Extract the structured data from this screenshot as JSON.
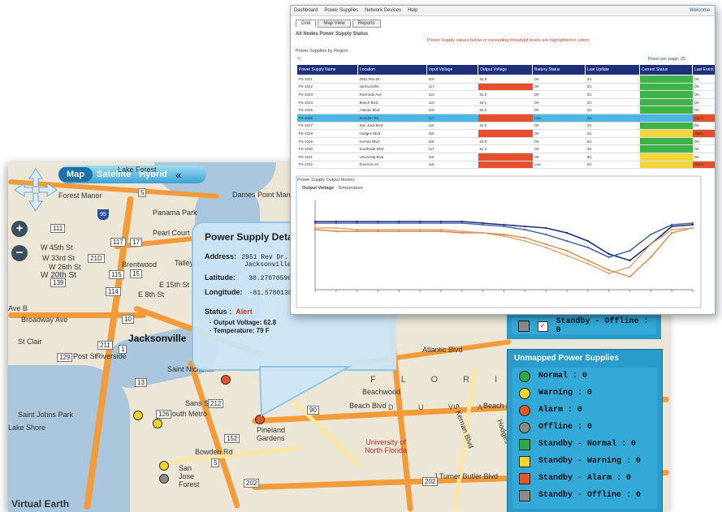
{
  "map": {
    "types": [
      "Map",
      "Satellite",
      "Hybrid"
    ],
    "collapse": "«",
    "labels": {
      "jacksonville": "Jacksonville",
      "lake_forest": "Lake Forest",
      "forest_manor": "Forest Manor",
      "dames_point": "Dames Point Manor",
      "panama_park": "Panama Park",
      "pearl_court": "Pearl Court",
      "brentwood": "Brentwood",
      "talleyrand": "Talleyrand",
      "w45": "W 45th St",
      "w33": "W 33rd St",
      "w26": "W 26th St",
      "w20": "W 20th St",
      "e8": "E 8th St",
      "e15": "E 15th St",
      "ave_b": "Ave B",
      "broadway": "Broadway Ave",
      "st_clair": "St Clair",
      "riverside": "Riverside",
      "post_st": "Post St",
      "saint_nicholas": "Saint Nicholas",
      "sans_souci": "Sans Souci",
      "south_metro": "South Metro",
      "pineland": "Pineland Gardens",
      "bowden": "Bowden Rd",
      "san_jose": "San Jose Forest",
      "st_johns": "Saint Johns Park",
      "lake_shore": "Lake Shore",
      "beachwood": "Beachwood",
      "beach_blvd": "Beach Blvd",
      "atlantic": "Atlantic Blvd",
      "florida": "F L O R I D A",
      "duval": "D U V A L",
      "unf": "University of North Florida",
      "turner": "J Turner Butler Blvd",
      "kernan": "S Kernan Blvd",
      "hodges": "Hodges Blvd",
      "watermark": "Virtual Earth"
    },
    "shields": [
      "5",
      "111",
      "117",
      "17",
      "115",
      "115",
      "15",
      "211",
      "139",
      "21",
      "114",
      "10",
      "1",
      "129",
      "211",
      "21D",
      "13",
      "126",
      "212",
      "90",
      "90",
      "152",
      "5",
      "202",
      "202"
    ],
    "popup": {
      "title": "Power Supply Detail: V",
      "address_label": "Address:",
      "address_line1": "2951 Rev Dr.",
      "address_line2": "Jacksonville, FL 3",
      "latitude_label": "Latitude:",
      "latitude": "30.27070596",
      "longitude_label": "Longitude:",
      "longitude": "-81.57801389",
      "status_label": "Status :",
      "status_value": "Alert",
      "output_voltage": "· Output Voltage: 62.8",
      "temperature": "· Temperature: 79 F"
    },
    "mapped_top_row": "Standby - Offline : 0",
    "unmapped": {
      "title": "Unmapped Power Supplies",
      "items": [
        {
          "label": "Normal : 0",
          "color": "#2ea84a",
          "shape": "circle"
        },
        {
          "label": "Warning : 0",
          "color": "#f2d526",
          "shape": "circle"
        },
        {
          "label": "Alarm : 0",
          "color": "#e2572c",
          "shape": "circle"
        },
        {
          "label": "Offline : 0",
          "color": "#8a8a8a",
          "shape": "circle"
        },
        {
          "label": "Standby - Normal : 0",
          "color": "#2ea84a",
          "shape": "square"
        },
        {
          "label": "Standby - Warning : 0",
          "color": "#f2d526",
          "shape": "square"
        },
        {
          "label": "Standby - Alarm : 0",
          "color": "#e2572c",
          "shape": "square"
        },
        {
          "label": "Standby - Offline : 0",
          "color": "#8a8a8a",
          "shape": "square"
        }
      ]
    },
    "pins": [
      {
        "color": "#e2572c"
      },
      {
        "color": "#e2572c"
      },
      {
        "color": "#f2d526"
      },
      {
        "color": "#f2d526"
      },
      {
        "color": "#f2d526"
      },
      {
        "color": "#8a8a8a"
      }
    ]
  },
  "app": {
    "toolbar": [
      "Dashboard",
      "Power Supplies",
      "Network Devices",
      "Help"
    ],
    "toolbar_right": "Welcome",
    "tabs": [
      "Grid",
      "Map View",
      "Reports"
    ],
    "heading": "All Nodes Power Supply Status",
    "alert_text": "Power Supply values below or exceeding threshold levels are highlighted in colors",
    "section_label": "Power Supplies by Region",
    "page_info": "Rows per page: 25",
    "columns": [
      "Power Supply Name",
      "Location",
      "Input Voltage",
      "Output Voltage",
      "Battery Status",
      "Last Update",
      "Current Status",
      "Last Event"
    ],
    "rows": [
      {
        "cells": [
          "PS-1021",
          "2951 Rev Dr.",
          "118",
          "62.8",
          "OK",
          "3/1",
          "",
          "OK"
        ],
        "flags": [
          "",
          "",
          "",
          "",
          "",
          "",
          "G",
          ""
        ]
      },
      {
        "cells": [
          "PS-1022",
          "Jacksonville",
          "117",
          "",
          "OK",
          "3/1",
          "",
          "OK"
        ],
        "flags": [
          "",
          "",
          "",
          "R",
          "",
          "",
          "G",
          ""
        ]
      },
      {
        "cells": [
          "PS-1023",
          "Riverside Ave",
          "119",
          "61.9",
          "OK",
          "3/1",
          "",
          "OK"
        ],
        "flags": [
          "",
          "",
          "",
          "",
          "",
          "",
          "G",
          ""
        ]
      },
      {
        "cells": [
          "PS-1024",
          "Beach Blvd",
          "116",
          "62.1",
          "OK",
          "3/1",
          "",
          "OK"
        ],
        "flags": [
          "",
          "",
          "",
          "",
          "",
          "",
          "G",
          ""
        ]
      },
      {
        "cells": [
          "PS-1025",
          "Atlantic Blvd",
          "118",
          "62.4",
          "OK",
          "3/1",
          "",
          "OK"
        ],
        "flags": [
          "",
          "",
          "",
          "",
          "",
          "",
          "G",
          ""
        ]
      },
      {
        "cells": [
          "PS-1026",
          "Bowden Rd",
          "117",
          "",
          "Low",
          "3/1",
          "",
          "Alarm"
        ],
        "flags": [
          "",
          "",
          "",
          "R",
          "",
          "",
          "",
          "R"
        ]
      },
      {
        "cells": [
          "PS-1027",
          "San Jose Blvd",
          "118",
          "62.0",
          "OK",
          "3/1",
          "",
          "OK"
        ],
        "flags": [
          "",
          "",
          "",
          "",
          "",
          "",
          "G",
          ""
        ]
      },
      {
        "cells": [
          "PS-1028",
          "Hodges Blvd",
          "115",
          "",
          "OK",
          "3/1",
          "",
          "Alarm"
        ],
        "flags": [
          "",
          "",
          "",
          "R",
          "",
          "",
          "Y",
          "R"
        ]
      },
      {
        "cells": [
          "PS-1029",
          "Kernan Blvd",
          "118",
          "62.6",
          "OK",
          "3/1",
          "",
          "OK"
        ],
        "flags": [
          "",
          "",
          "",
          "",
          "",
          "",
          "G",
          ""
        ]
      },
      {
        "cells": [
          "PS-1030",
          "Southside Blvd",
          "117",
          "62.3",
          "OK",
          "3/1",
          "",
          "OK"
        ],
        "flags": [
          "",
          "",
          "",
          "",
          "",
          "",
          "G",
          ""
        ]
      },
      {
        "cells": [
          "PS-1031",
          "University Blvd",
          "116",
          "",
          "OK",
          "3/1",
          "",
          "OK"
        ],
        "flags": [
          "",
          "",
          "",
          "R",
          "",
          "",
          "Y",
          ""
        ]
      },
      {
        "cells": [
          "PS-1032",
          "Emerson St",
          "118",
          "",
          "Low",
          "3/1",
          "",
          "Alarm"
        ],
        "flags": [
          "",
          "",
          "",
          "R",
          "",
          "",
          "Y",
          "R"
        ]
      }
    ],
    "chart_section": "Power Supply Output History",
    "chart_tabs": [
      "Output Voltage",
      "Temperature"
    ]
  },
  "chart_data": {
    "type": "line",
    "series": [
      {
        "color": "#1e2f7b",
        "values": [
          52,
          52,
          52,
          52,
          52,
          52,
          52,
          52,
          51,
          50,
          49,
          48,
          45,
          40,
          32,
          28,
          38,
          49,
          50
        ]
      },
      {
        "color": "#4a6aa8",
        "values": [
          51,
          51,
          51,
          51,
          51,
          51,
          51,
          51,
          50,
          49,
          47,
          44,
          40,
          36,
          30,
          34,
          44,
          50,
          51
        ]
      },
      {
        "color": "#d8874a",
        "values": [
          47,
          46,
          46,
          46,
          46,
          46,
          46,
          45,
          45,
          44,
          42,
          38,
          34,
          28,
          22,
          18,
          30,
          45,
          48
        ]
      },
      {
        "color": "#e2a36b",
        "values": [
          48,
          48,
          47,
          47,
          47,
          47,
          47,
          46,
          45,
          43,
          40,
          36,
          31,
          26,
          20,
          24,
          38,
          47,
          48
        ]
      }
    ],
    "ylim": [
      10,
      60
    ]
  },
  "colors": {
    "accent": "#2a9ccc",
    "header": "#1e2f7b",
    "alarm": "#e4502e",
    "normal": "#3fb24a",
    "warning": "#f4d63a"
  }
}
